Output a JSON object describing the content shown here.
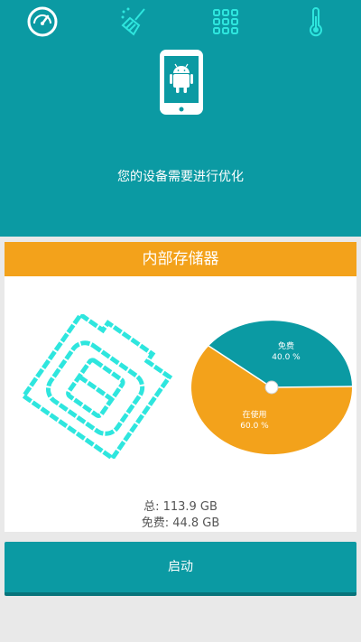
{
  "header": {
    "tabs": [
      {
        "name": "speedometer-icon"
      },
      {
        "name": "broom-icon"
      },
      {
        "name": "app-grid-icon"
      },
      {
        "name": "thermometer-icon"
      }
    ],
    "message": "您的设备需要进行优化"
  },
  "card": {
    "title": "内部存储器",
    "pie": {
      "free_label": "免费",
      "free_value": "40.0 %",
      "used_label": "在使用",
      "used_value": "60.0 %"
    },
    "total": "总: 113.9 GB",
    "free": "免费: 44.8 GB"
  },
  "start_button": "启动",
  "colors": {
    "accent": "#0b9aa3",
    "orange": "#f3a21b",
    "cyan_icon": "#2ee6de"
  }
}
